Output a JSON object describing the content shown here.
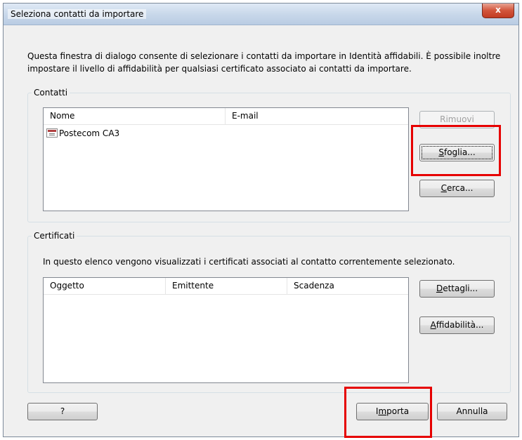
{
  "window": {
    "title": "Seleziona contatti da importare",
    "close_glyph": "x"
  },
  "description": "Questa finestra di dialogo consente di selezionare i contatti da importare in Identità affidabili. È possibile inoltre impostare il livello di affidabilità per qualsiasi certificato associato ai contatti da importare.",
  "contacts": {
    "group_label": "Contatti",
    "columns": [
      "Nome",
      "E-mail"
    ],
    "rows": [
      {
        "icon": "certificate-icon",
        "name": "Postecom CA3",
        "email": ""
      }
    ],
    "buttons": {
      "remove": "Rimuovi",
      "browse_accel": "S",
      "browse_rest": "foglia...",
      "search_accel": "C",
      "search_rest": "erca..."
    }
  },
  "certificates": {
    "group_label": "Certificati",
    "info": "In questo elenco vengono visualizzati i certificati associati al contatto correntemente selezionato.",
    "columns": [
      "Oggetto",
      "Emittente",
      "Scadenza"
    ],
    "buttons": {
      "details_accel": "D",
      "details_rest": "ettagli...",
      "trust_accel": "A",
      "trust_rest": "ffidabilità..."
    }
  },
  "footer": {
    "help": "?",
    "import_pre": "I",
    "import_accel": "m",
    "import_rest": "porta",
    "cancel": "Annulla"
  },
  "highlight_color": "#e60000"
}
